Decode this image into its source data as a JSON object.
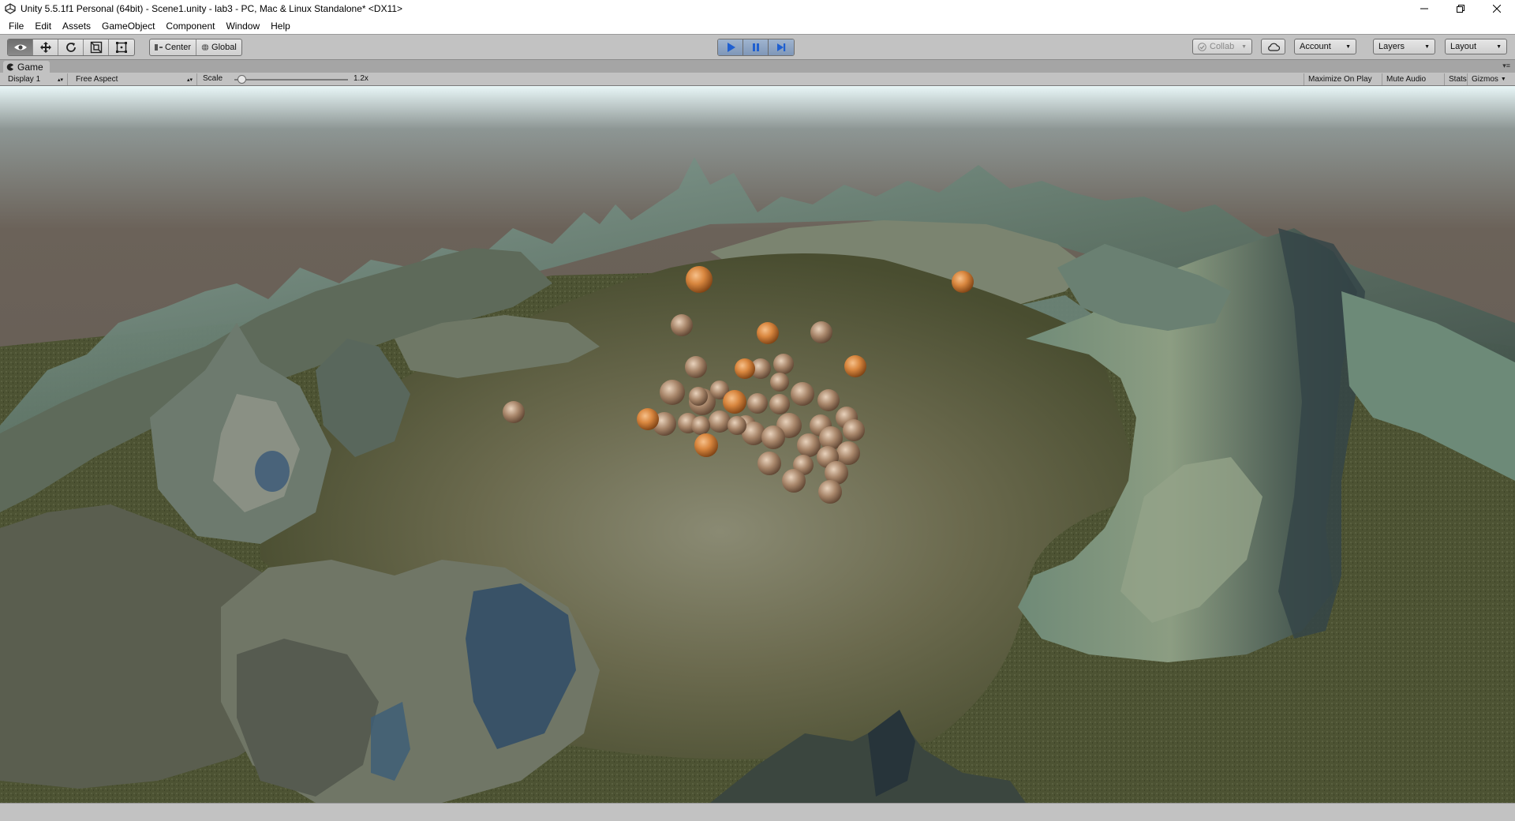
{
  "titlebar": {
    "title": "Unity 5.5.1f1 Personal (64bit) - Scene1.unity - lab3 - PC, Mac & Linux Standalone* <DX11>"
  },
  "menu": {
    "items": [
      "File",
      "Edit",
      "Assets",
      "GameObject",
      "Component",
      "Window",
      "Help"
    ]
  },
  "toolbar": {
    "transform_tools": [
      "hand-tool",
      "move-tool",
      "rotate-tool",
      "scale-tool",
      "rect-tool"
    ],
    "active_tool": "hand-tool",
    "pivot_mode": "Center",
    "pivot_rotation": "Global",
    "play_state": "playing",
    "collab_label": "Collab",
    "account_label": "Account",
    "layers_label": "Layers",
    "layout_label": "Layout"
  },
  "game_view": {
    "tab_label": "Game",
    "display": "Display 1",
    "aspect": "Free Aspect",
    "scale_label": "Scale",
    "scale_value": "1.2x",
    "scale_fraction": 0.06,
    "maximize_on_play": "Maximize On Play",
    "mute_audio": "Mute Audio",
    "stats": "Stats",
    "gizmos": "Gizmos"
  },
  "colors": {
    "editor_bg": "#c2c2c2",
    "play_accent": "#2f6fd6",
    "sky": "#676058",
    "terrain": "#4e5434",
    "sphere_orange": "#d4863f",
    "sphere_rock": "#a8866a"
  }
}
